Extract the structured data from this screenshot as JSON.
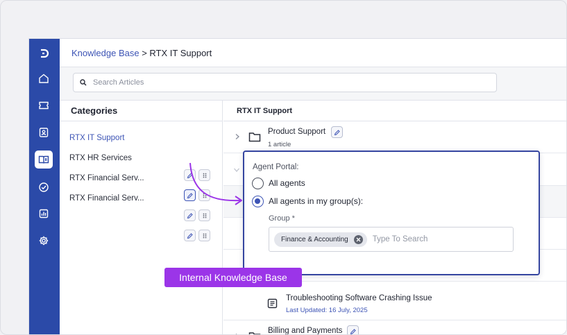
{
  "breadcrumb": {
    "root": "Knowledge Base",
    "separator": " > ",
    "current": "RTX IT Support"
  },
  "search": {
    "placeholder": "Search Articles"
  },
  "categories": {
    "title": "Categories",
    "items": [
      {
        "label": "RTX IT Support",
        "selected": true
      },
      {
        "label": "RTX HR Services",
        "selected": false
      },
      {
        "label": "RTX Financial Serv...",
        "selected": false
      },
      {
        "label": "RTX Financial Serv...",
        "selected": false
      }
    ]
  },
  "articles": {
    "title": "RTX IT Support",
    "folders": [
      {
        "name": "Product Support",
        "count": "1 article"
      },
      {
        "name": "Billing and Payments"
      }
    ],
    "article": {
      "title": "Troubleshooting Software Crashing Issue",
      "updated": "Last Updated: 16 July, 2025"
    }
  },
  "popover": {
    "label": "Agent Portal:",
    "options": [
      {
        "label": "All agents",
        "checked": false
      },
      {
        "label": "All agents in my group(s):",
        "checked": true
      }
    ],
    "group_label": "Group *",
    "chip": "Finance & Accounting",
    "group_placeholder": "Type To Search"
  },
  "callout": "Internal Knowledge Base",
  "colors": {
    "sidebar": "#2b4aa8",
    "accent": "#3d54b5",
    "callout": "#9b35e8",
    "popover_border": "#3545a0"
  },
  "icons": {
    "sidebar": [
      "logo-icon",
      "home-icon",
      "ticket-icon",
      "contact-icon",
      "knowledge-base-icon",
      "task-check-icon",
      "reports-icon",
      "settings-icon"
    ],
    "category_actions": [
      "visibility-edit-icon",
      "drag-handle-icon"
    ]
  }
}
